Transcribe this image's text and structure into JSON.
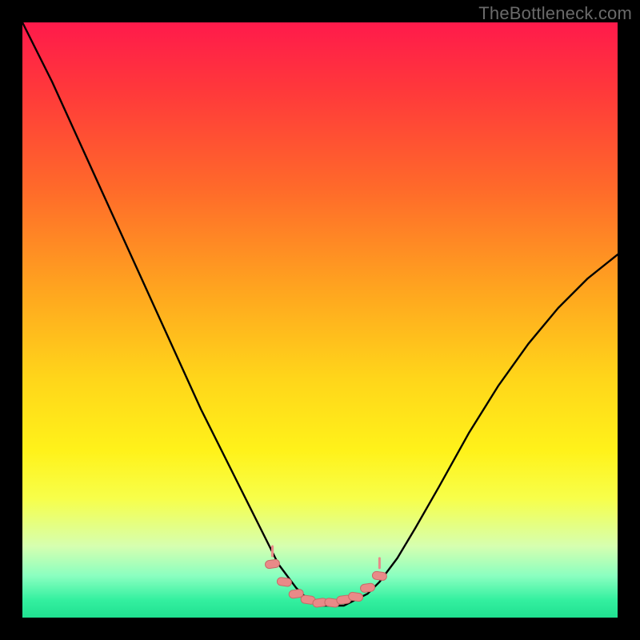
{
  "watermark": "TheBottleneck.com",
  "palette": {
    "curve_stroke": "#000000",
    "marker_fill": "#e98a88",
    "marker_stroke": "#c86a68",
    "frame_border": "#000000"
  },
  "chart_data": {
    "type": "line",
    "title": "",
    "xlabel": "",
    "ylabel": "",
    "xlim": [
      0,
      100
    ],
    "ylim": [
      0,
      100
    ],
    "grid": false,
    "series": [
      {
        "name": "bottleneck-curve",
        "x": [
          0,
          5,
          10,
          15,
          20,
          25,
          30,
          35,
          40,
          43,
          46,
          48,
          50,
          52,
          54,
          56,
          58,
          60,
          63,
          66,
          70,
          75,
          80,
          85,
          90,
          95,
          100
        ],
        "y": [
          100,
          90,
          79,
          68,
          57,
          46,
          35,
          25,
          15,
          9,
          5,
          3,
          2,
          2,
          2,
          3,
          4,
          6,
          10,
          15,
          22,
          31,
          39,
          46,
          52,
          57,
          61
        ]
      }
    ],
    "markers": {
      "name": "highlight-points",
      "x": [
        42,
        44,
        46,
        48,
        50,
        52,
        54,
        56,
        58,
        60
      ],
      "y": [
        9,
        6,
        4,
        3,
        2.5,
        2.5,
        3,
        3.5,
        5,
        7
      ]
    }
  }
}
